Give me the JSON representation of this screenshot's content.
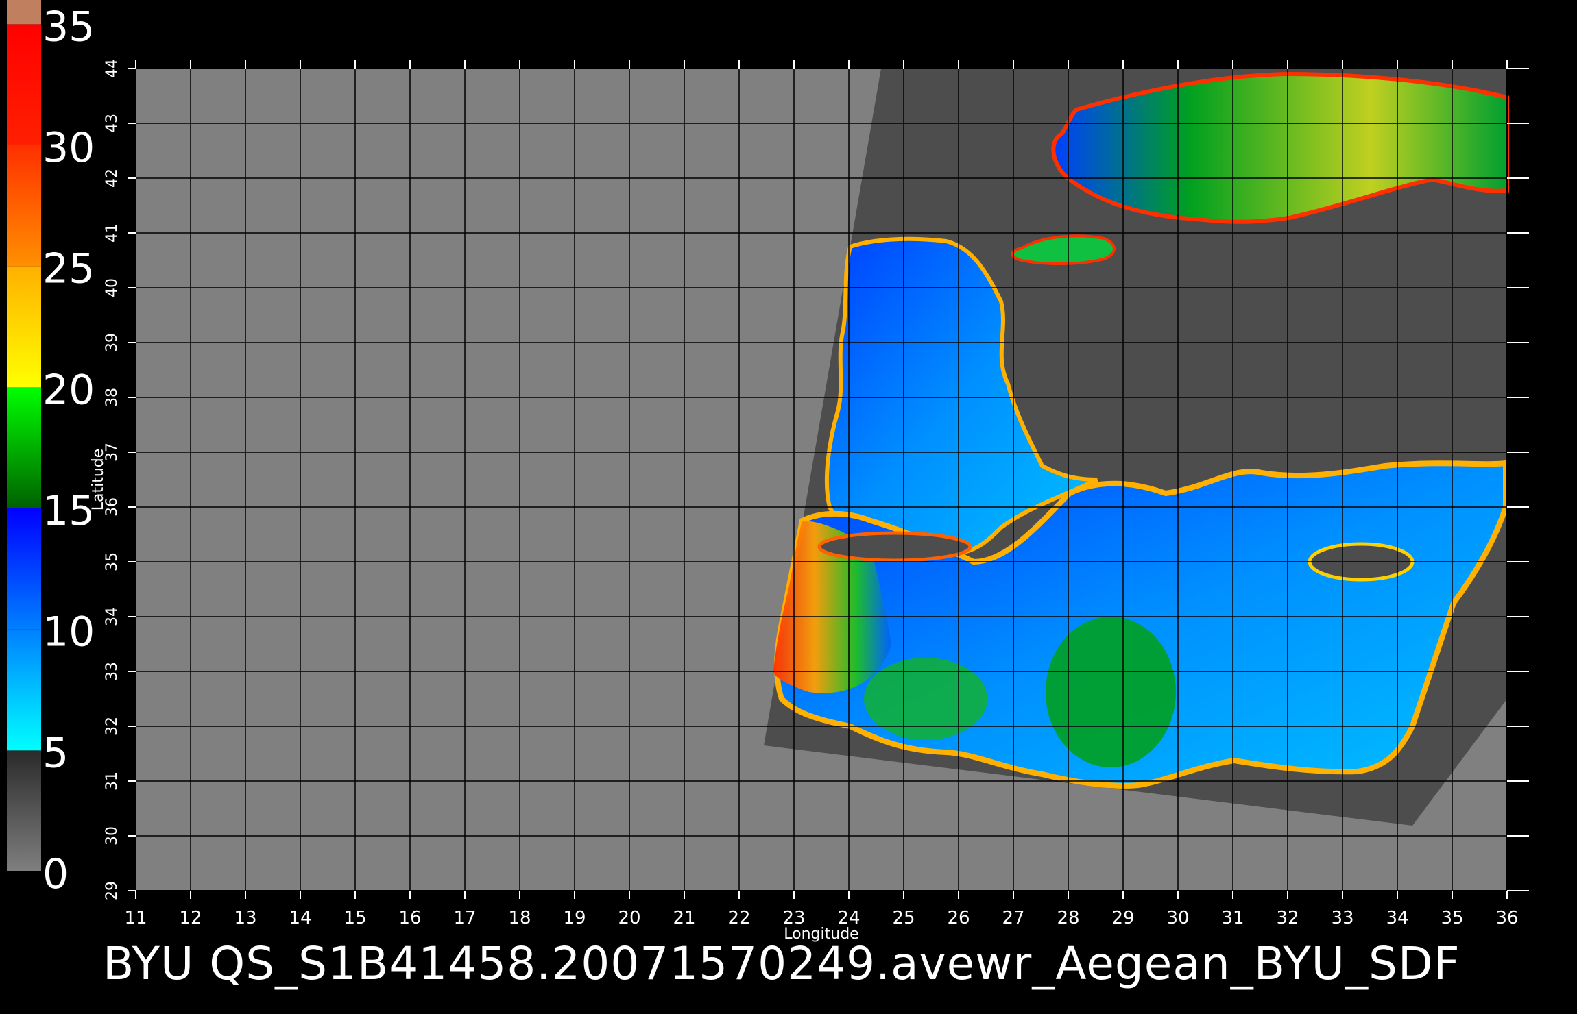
{
  "colorbar": {
    "labels": [
      "35",
      "30",
      "25",
      "20",
      "15",
      "10",
      "5",
      "0"
    ],
    "segments": [
      {
        "from": 0,
        "to": 5,
        "colors": [
          "#7f7f7f",
          "#2a2a2a"
        ]
      },
      {
        "from": 5,
        "to": 10,
        "colors": [
          "#00ffff",
          "#0080ff"
        ]
      },
      {
        "from": 10,
        "to": 15,
        "colors": [
          "#0080ff",
          "#0000ff"
        ]
      },
      {
        "from": 15,
        "to": 20,
        "colors": [
          "#006000",
          "#00ff00"
        ]
      },
      {
        "from": 20,
        "to": 25,
        "colors": [
          "#ffff00",
          "#ffb000"
        ]
      },
      {
        "from": 25,
        "to": 30,
        "colors": [
          "#ff9000",
          "#ff3000"
        ]
      },
      {
        "from": 30,
        "to": 35,
        "colors": [
          "#ff2000",
          "#ff0000"
        ]
      },
      {
        "from": 35,
        "to": 36,
        "colors": [
          "#c08060",
          "#c08060"
        ]
      }
    ]
  },
  "axes": {
    "x_label": "Longitude",
    "y_label": "Latitude",
    "lon_ticks": [
      "11",
      "12",
      "13",
      "14",
      "15",
      "16",
      "17",
      "18",
      "19",
      "20",
      "21",
      "22",
      "23",
      "24",
      "25",
      "26",
      "27",
      "28",
      "29",
      "30",
      "31",
      "32",
      "33",
      "34",
      "35",
      "36"
    ],
    "lat_ticks": [
      "29",
      "30",
      "31",
      "32",
      "33",
      "34",
      "35",
      "36",
      "37",
      "38",
      "39",
      "40",
      "41",
      "42",
      "43",
      "44"
    ],
    "lon_range": [
      11,
      36
    ],
    "lat_range": [
      29,
      44
    ]
  },
  "footer": {
    "title": "BYU  QS_S1B41458.20071570249.avewr_Aegean_BYU_SDF"
  },
  "colors": {
    "background": "#000000",
    "map_nodata": "#808080",
    "swath_land": "#4d4d4d",
    "grid": "#000000"
  }
}
